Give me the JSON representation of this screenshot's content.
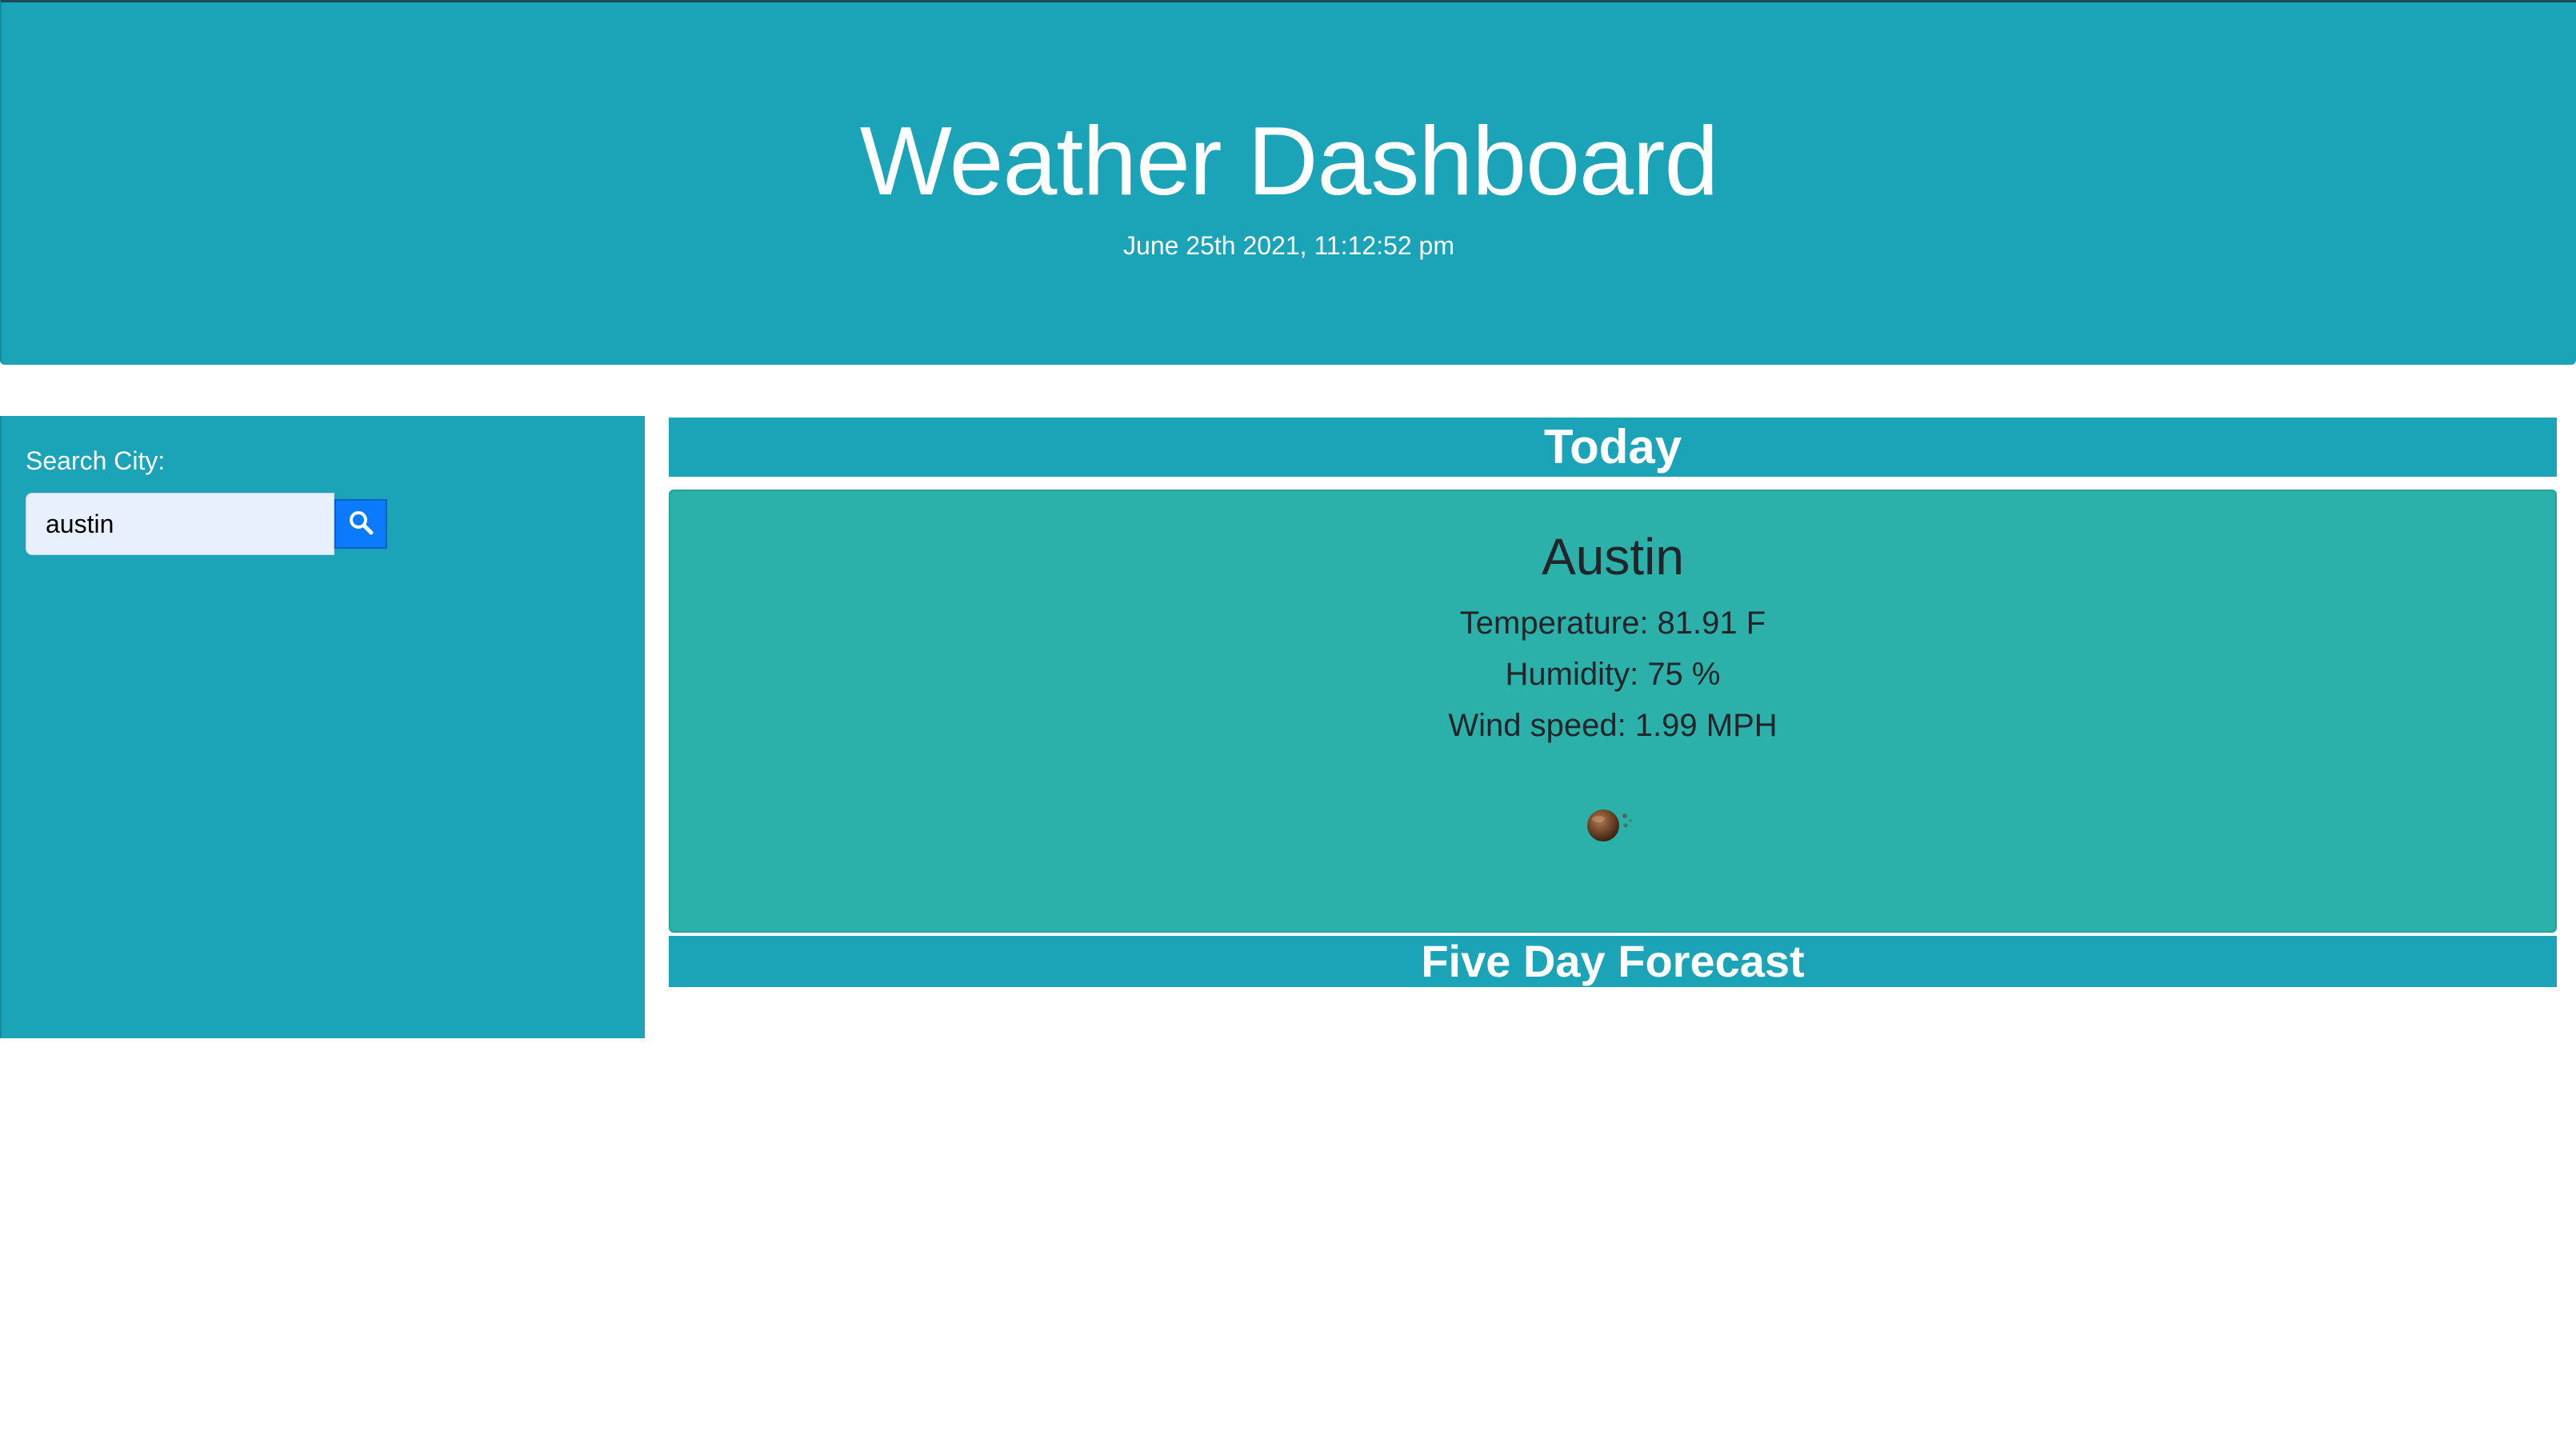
{
  "header": {
    "title": "Weather Dashboard",
    "datetime": "June 25th 2021, 11:12:52 pm"
  },
  "sidebar": {
    "search_label": "Search City:",
    "search_value": "austin",
    "search_button_icon": "search-icon"
  },
  "today": {
    "heading": "Today",
    "city": "Austin",
    "temperature": "Temperature: 81.91 F",
    "humidity": "Humidity: 75 %",
    "wind": "Wind speed: 1.99 MPH",
    "icon": "weather-condition-icon"
  },
  "forecast": {
    "heading": "Five Day Forecast"
  },
  "colors": {
    "header_bg": "#1ba3b8",
    "card_bg": "#2bb0aa",
    "button_bg": "#0a7bff",
    "input_bg": "#e8f0fe"
  }
}
